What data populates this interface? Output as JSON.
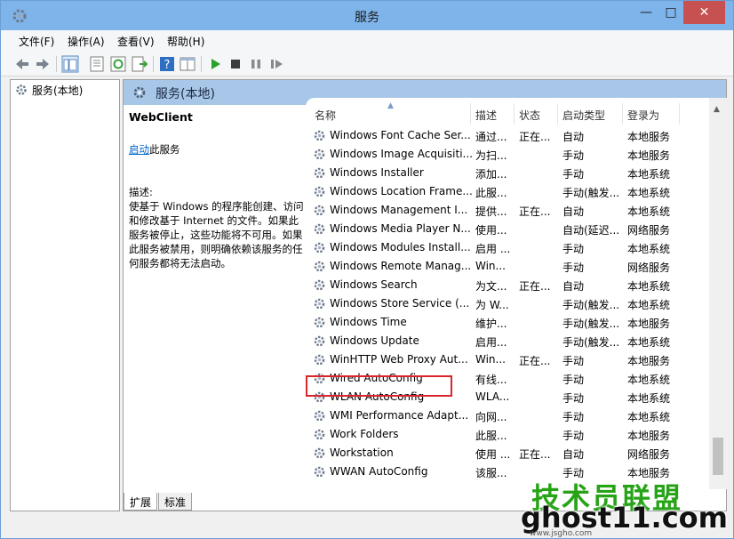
{
  "window": {
    "title": "服务"
  },
  "window_buttons": {
    "minimize": "—",
    "maximize": "□",
    "close": "✕"
  },
  "menu": [
    "文件(F)",
    "操作(A)",
    "查看(V)",
    "帮助(H)"
  ],
  "tree": {
    "root": "服务(本地)"
  },
  "pane": {
    "header": "服务(本地)"
  },
  "details": {
    "service_name": "WebClient",
    "start_link": "启动",
    "start_suffix": "此服务",
    "desc_label": "描述:",
    "desc_text": "使基于 Windows 的程序能创建、访问和修改基于 Internet 的文件。如果此服务被停止，这些功能将不可用。如果此服务被禁用，则明确依赖该服务的任何服务都将无法启动。"
  },
  "columns": [
    "名称",
    "描述",
    "状态",
    "启动类型",
    "登录为"
  ],
  "services": [
    {
      "name": "Windows Font Cache Ser...",
      "desc": "通过...",
      "state": "正在...",
      "start": "自动",
      "logon": "本地服务"
    },
    {
      "name": "Windows Image Acquisiti...",
      "desc": "为扫...",
      "state": "",
      "start": "手动",
      "logon": "本地服务"
    },
    {
      "name": "Windows Installer",
      "desc": "添加...",
      "state": "",
      "start": "手动",
      "logon": "本地系统"
    },
    {
      "name": "Windows Location Frame...",
      "desc": "此服...",
      "state": "",
      "start": "手动(触发...",
      "logon": "本地系统"
    },
    {
      "name": "Windows Management I...",
      "desc": "提供...",
      "state": "正在...",
      "start": "自动",
      "logon": "本地系统"
    },
    {
      "name": "Windows Media Player N...",
      "desc": "使用...",
      "state": "",
      "start": "自动(延迟...",
      "logon": "网络服务"
    },
    {
      "name": "Windows Modules Install...",
      "desc": "启用 ...",
      "state": "",
      "start": "手动",
      "logon": "本地系统"
    },
    {
      "name": "Windows Remote Manag...",
      "desc": "Win...",
      "state": "",
      "start": "手动",
      "logon": "网络服务"
    },
    {
      "name": "Windows Search",
      "desc": "为文...",
      "state": "正在...",
      "start": "自动",
      "logon": "本地系统"
    },
    {
      "name": "Windows Store Service (...",
      "desc": "为 W...",
      "state": "",
      "start": "手动(触发...",
      "logon": "本地系统"
    },
    {
      "name": "Windows Time",
      "desc": "维护...",
      "state": "",
      "start": "手动(触发...",
      "logon": "本地服务"
    },
    {
      "name": "Windows Update",
      "desc": "启用...",
      "state": "",
      "start": "手动(触发...",
      "logon": "本地系统"
    },
    {
      "name": "WinHTTP Web Proxy Aut...",
      "desc": "Win...",
      "state": "正在...",
      "start": "手动",
      "logon": "本地服务"
    },
    {
      "name": "Wired AutoConfig",
      "desc": "有线...",
      "state": "",
      "start": "手动",
      "logon": "本地系统"
    },
    {
      "name": "WLAN AutoConfig",
      "desc": "WLA...",
      "state": "",
      "start": "手动",
      "logon": "本地系统"
    },
    {
      "name": "WMI Performance Adapt...",
      "desc": "向网...",
      "state": "",
      "start": "手动",
      "logon": "本地系统"
    },
    {
      "name": "Work Folders",
      "desc": "此服...",
      "state": "",
      "start": "手动",
      "logon": "本地服务"
    },
    {
      "name": "Workstation",
      "desc": "使用 ...",
      "state": "正在...",
      "start": "自动",
      "logon": "网络服务"
    },
    {
      "name": "WWAN AutoConfig",
      "desc": "该服...",
      "state": "",
      "start": "手动",
      "logon": "本地服务"
    }
  ],
  "tabs": [
    "扩展",
    "标准"
  ],
  "watermark": {
    "line1": "技术员联盟",
    "line2": "ghost11.com",
    "url": "www.jsgho.com"
  },
  "colors": {
    "titlebar": "#7eb4ea",
    "close": "#c75050",
    "highlight": "#d9262b",
    "link": "#0066cc"
  }
}
